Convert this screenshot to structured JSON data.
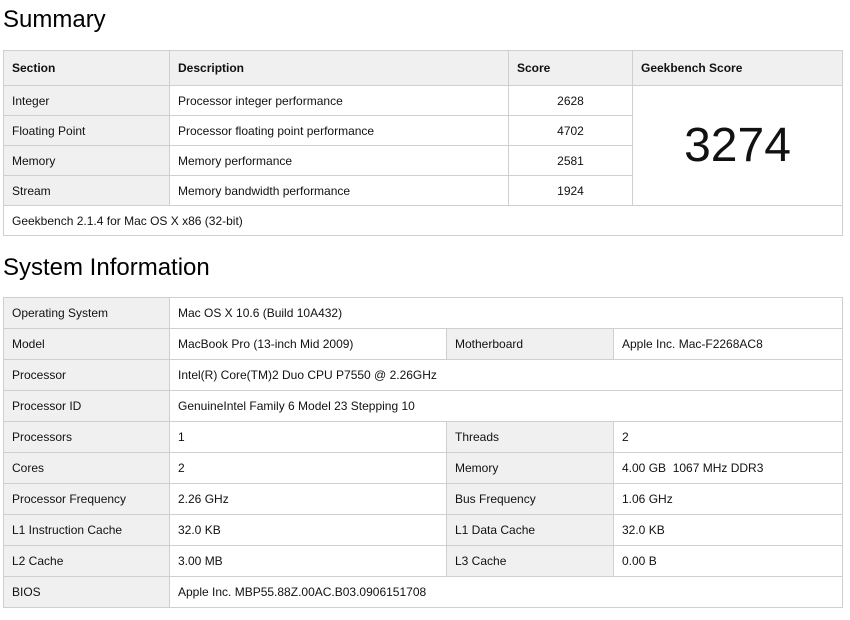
{
  "summary": {
    "heading": "Summary",
    "headers": {
      "section": "Section",
      "description": "Description",
      "score": "Score",
      "geekbench_score": "Geekbench Score"
    },
    "rows": [
      {
        "section": "Integer",
        "description": "Processor integer performance",
        "score": "2628"
      },
      {
        "section": "Floating Point",
        "description": "Processor floating point performance",
        "score": "4702"
      },
      {
        "section": "Memory",
        "description": "Memory performance",
        "score": "2581"
      },
      {
        "section": "Stream",
        "description": "Memory bandwidth performance",
        "score": "1924"
      }
    ],
    "total_score": "3274",
    "footer": "Geekbench 2.1.4 for Mac OS X x86 (32-bit)"
  },
  "system_info": {
    "heading": "System Information",
    "operating_system": {
      "label": "Operating System",
      "value": "Mac OS X 10.6 (Build 10A432)"
    },
    "model": {
      "label": "Model",
      "value": "MacBook Pro (13-inch Mid 2009)"
    },
    "motherboard": {
      "label": "Motherboard",
      "value": "Apple Inc. Mac-F2268AC8"
    },
    "processor": {
      "label": "Processor",
      "value": "Intel(R) Core(TM)2 Duo CPU P7550 @ 2.26GHz"
    },
    "processor_id": {
      "label": "Processor ID",
      "value": "GenuineIntel Family 6 Model 23 Stepping 10"
    },
    "processors": {
      "label": "Processors",
      "value": "1"
    },
    "threads": {
      "label": "Threads",
      "value": "2"
    },
    "cores": {
      "label": "Cores",
      "value": "2"
    },
    "memory": {
      "label": "Memory",
      "value": "4.00 GB  1067 MHz DDR3"
    },
    "processor_frequency": {
      "label": "Processor Frequency",
      "value": "2.26 GHz"
    },
    "bus_frequency": {
      "label": "Bus Frequency",
      "value": "1.06 GHz"
    },
    "l1_instruction_cache": {
      "label": "L1 Instruction Cache",
      "value": "32.0 KB"
    },
    "l1_data_cache": {
      "label": "L1 Data Cache",
      "value": "32.0 KB"
    },
    "l2_cache": {
      "label": "L2 Cache",
      "value": "3.00 MB"
    },
    "l3_cache": {
      "label": "L3 Cache",
      "value": "0.00 B"
    },
    "bios": {
      "label": "BIOS",
      "value": "Apple Inc. MBP55.88Z.00AC.B03.0906151708"
    }
  }
}
